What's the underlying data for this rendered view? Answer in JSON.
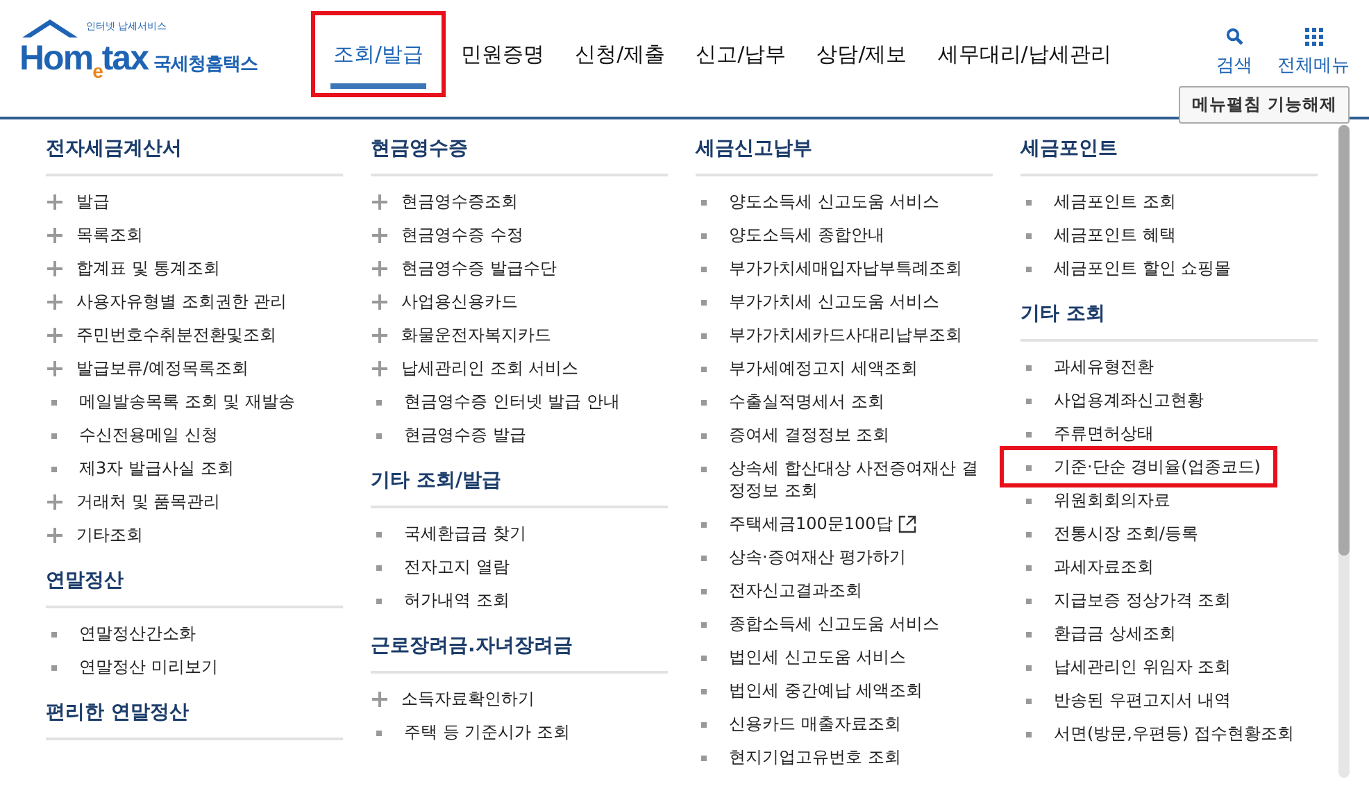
{
  "logo": {
    "tagline": "인터넷 납세서비스",
    "wordmark": "Hom$_{e}$tax",
    "org": "국세청홈택스"
  },
  "nav": [
    {
      "label": "조회/발급",
      "selected": true,
      "highlighted": true
    },
    {
      "label": "민원증명",
      "selected": false,
      "highlighted": false
    },
    {
      "label": "신청/제출",
      "selected": false,
      "highlighted": false
    },
    {
      "label": "신고/납부",
      "selected": false,
      "highlighted": false
    },
    {
      "label": "상담/제보",
      "selected": false,
      "highlighted": false
    },
    {
      "label": "세무대리/납세관리",
      "selected": false,
      "highlighted": false
    }
  ],
  "tools": [
    {
      "kind": "search",
      "label": "검색"
    },
    {
      "kind": "menu",
      "label": "전체메뉴"
    }
  ],
  "collapse_button": "메뉴펼침 기능해제",
  "columns": [
    {
      "sections": [
        {
          "title": "전자세금계산서",
          "items": [
            {
              "kind": "plus",
              "label": "발급",
              "highlighted": false
            },
            {
              "kind": "plus",
              "label": "목록조회",
              "highlighted": false
            },
            {
              "kind": "plus",
              "label": "합계표 및 통계조회",
              "highlighted": false
            },
            {
              "kind": "plus",
              "label": "사용자유형별 조회권한 관리",
              "highlighted": false
            },
            {
              "kind": "plus",
              "label": "주민번호수취분전환및조회",
              "highlighted": false
            },
            {
              "kind": "plus",
              "label": "발급보류/예정목록조회",
              "highlighted": false
            },
            {
              "kind": "bullet",
              "label": "메일발송목록 조회 및 재발송",
              "highlighted": false
            },
            {
              "kind": "bullet",
              "label": "수신전용메일 신청",
              "highlighted": false
            },
            {
              "kind": "bullet",
              "label": "제3자 발급사실 조회",
              "highlighted": false
            },
            {
              "kind": "plus",
              "label": "거래처 및 품목관리",
              "highlighted": false
            },
            {
              "kind": "plus",
              "label": "기타조회",
              "highlighted": false
            }
          ]
        },
        {
          "title": "연말정산",
          "items": [
            {
              "kind": "bullet",
              "label": "연말정산간소화",
              "highlighted": false
            },
            {
              "kind": "bullet",
              "label": "연말정산 미리보기",
              "highlighted": false
            }
          ]
        },
        {
          "title": "편리한 연말정산"
        }
      ]
    },
    {
      "sections": [
        {
          "title": "현금영수증",
          "items": [
            {
              "kind": "plus",
              "label": "현금영수증조회",
              "highlighted": false
            },
            {
              "kind": "plus",
              "label": "현금영수증 수정",
              "highlighted": false
            },
            {
              "kind": "plus",
              "label": "현금영수증 발급수단",
              "highlighted": false
            },
            {
              "kind": "plus",
              "label": "사업용신용카드",
              "highlighted": false
            },
            {
              "kind": "plus",
              "label": "화물운전자복지카드",
              "highlighted": false
            },
            {
              "kind": "plus",
              "label": "납세관리인 조회 서비스",
              "highlighted": false
            },
            {
              "kind": "bullet",
              "label": "현금영수증 인터넷 발급 안내",
              "highlighted": false
            },
            {
              "kind": "bullet",
              "label": "현금영수증 발급",
              "highlighted": false
            }
          ]
        },
        {
          "title": "기타 조회/발급",
          "items": [
            {
              "kind": "bullet",
              "label": "국세환급금 찾기",
              "highlighted": false
            },
            {
              "kind": "bullet",
              "label": "전자고지 열람",
              "highlighted": false
            },
            {
              "kind": "bullet",
              "label": "허가내역 조회",
              "highlighted": false
            }
          ]
        },
        {
          "title": "근로장려금.자녀장려금",
          "items": [
            {
              "kind": "plus",
              "label": "소득자료확인하기",
              "highlighted": false
            },
            {
              "kind": "bullet",
              "label": "주택 등 기준시가 조회",
              "highlighted": false
            }
          ]
        }
      ]
    },
    {
      "sections": [
        {
          "title": "세금신고납부",
          "items": [
            {
              "kind": "bullet",
              "label": "양도소득세 신고도움 서비스",
              "highlighted": false
            },
            {
              "kind": "bullet",
              "label": "양도소득세 종합안내",
              "highlighted": false
            },
            {
              "kind": "bullet",
              "label": "부가가치세매입자납부특례조회",
              "highlighted": false
            },
            {
              "kind": "bullet",
              "label": "부가가치세 신고도움 서비스",
              "highlighted": false
            },
            {
              "kind": "bullet",
              "label": "부가가치세카드사대리납부조회",
              "highlighted": false
            },
            {
              "kind": "bullet",
              "label": "부가세예정고지 세액조회",
              "highlighted": false
            },
            {
              "kind": "bullet",
              "label": "수출실적명세서 조회",
              "highlighted": false
            },
            {
              "kind": "bullet",
              "label": "증여세 결정정보 조회",
              "highlighted": false
            },
            {
              "kind": "bullet",
              "label": "상속세 합산대상 사전증여재산 결정정보 조회",
              "highlighted": false
            },
            {
              "kind": "external",
              "label": "주택세금100문100답",
              "highlighted": false
            },
            {
              "kind": "bullet",
              "label": "상속·증여재산 평가하기",
              "highlighted": false
            },
            {
              "kind": "bullet",
              "label": "전자신고결과조회",
              "highlighted": false
            },
            {
              "kind": "bullet",
              "label": "종합소득세 신고도움 서비스",
              "highlighted": false
            },
            {
              "kind": "bullet",
              "label": "법인세 신고도움 서비스",
              "highlighted": false
            },
            {
              "kind": "bullet",
              "label": "법인세 중간예납 세액조회",
              "highlighted": false
            },
            {
              "kind": "bullet",
              "label": "신용카드 매출자료조회",
              "highlighted": false
            },
            {
              "kind": "bullet",
              "label": "현지기업고유번호 조회",
              "highlighted": false
            }
          ]
        }
      ]
    },
    {
      "sections": [
        {
          "title": "세금포인트",
          "items": [
            {
              "kind": "bullet",
              "label": "세금포인트 조회",
              "highlighted": false
            },
            {
              "kind": "bullet",
              "label": "세금포인트 혜택",
              "highlighted": false
            },
            {
              "kind": "bullet",
              "label": "세금포인트 할인 쇼핑몰",
              "highlighted": false
            }
          ]
        },
        {
          "title": "기타 조회",
          "items": [
            {
              "kind": "bullet",
              "label": "과세유형전환",
              "highlighted": false
            },
            {
              "kind": "bullet",
              "label": "사업용계좌신고현황",
              "highlighted": false
            },
            {
              "kind": "bullet",
              "label": "주류면허상태",
              "highlighted": false
            },
            {
              "kind": "bullet",
              "label": "기준·단순 경비율(업종코드)",
              "highlighted": true
            },
            {
              "kind": "bullet",
              "label": "위원회회의자료",
              "highlighted": false
            },
            {
              "kind": "bullet",
              "label": "전통시장 조회/등록",
              "highlighted": false
            },
            {
              "kind": "bullet",
              "label": "과세자료조회",
              "highlighted": false
            },
            {
              "kind": "bullet",
              "label": "지급보증 정상가격 조회",
              "highlighted": false
            },
            {
              "kind": "bullet",
              "label": "환급금 상세조회",
              "highlighted": false
            },
            {
              "kind": "bullet",
              "label": "납세관리인 위임자 조회",
              "highlighted": false
            },
            {
              "kind": "bullet",
              "label": "반송된 우편고지서 내역",
              "highlighted": false
            },
            {
              "kind": "bullet",
              "label": "서면(방문,우편등) 접수현황조회",
              "highlighted": false
            }
          ]
        }
      ]
    }
  ]
}
